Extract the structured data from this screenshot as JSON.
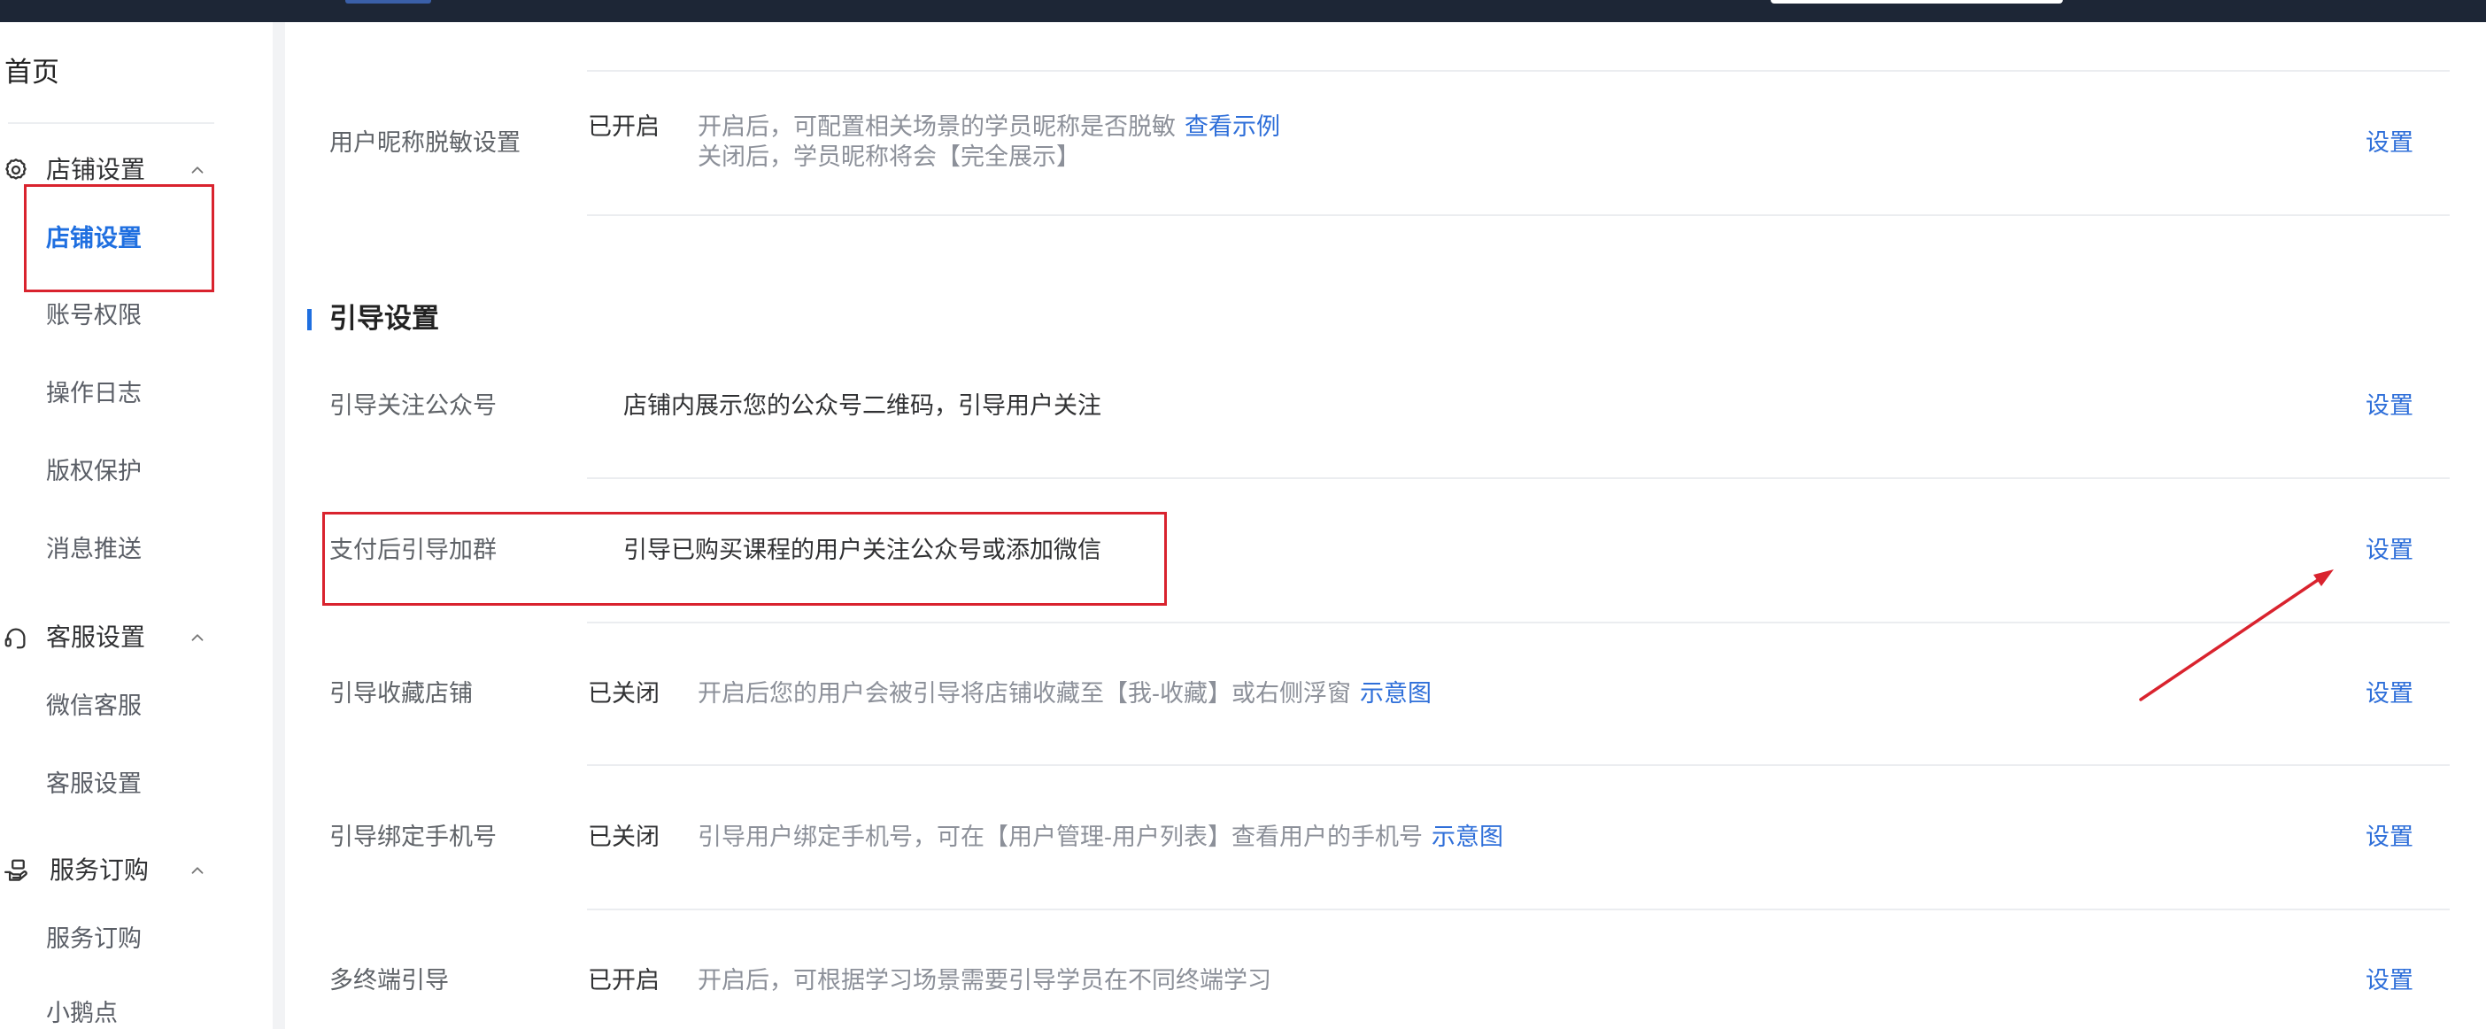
{
  "colors": {
    "topbar": "#1d2636",
    "accent": "#1f6fe0",
    "link": "#2f6fd9",
    "annotation": "#d9232e"
  },
  "sidebar": {
    "home": "首页",
    "groups": [
      {
        "title": "店铺设置",
        "icon": "gear-icon",
        "expanded": true,
        "items": [
          {
            "label": "店铺设置",
            "active": true
          },
          {
            "label": "账号权限"
          },
          {
            "label": "操作日志"
          },
          {
            "label": "版权保护"
          },
          {
            "label": "消息推送"
          }
        ]
      },
      {
        "title": "客服设置",
        "icon": "headset-icon",
        "expanded": true,
        "items": [
          {
            "label": "微信客服"
          },
          {
            "label": "客服设置"
          }
        ]
      },
      {
        "title": "服务订购",
        "icon": "hand-service-icon",
        "expanded": true,
        "items": [
          {
            "label": "服务订购"
          },
          {
            "label": "小鹅点"
          }
        ]
      }
    ]
  },
  "settings": {
    "nickname_row": {
      "label": "用户昵称脱敏设置",
      "status": "已开启",
      "desc_line1": "开启后，可配置相关场景的学员昵称是否脱敏",
      "link": "查看示例",
      "desc_line2": "关闭后，学员昵称将会【完全展示】",
      "action": "设置"
    },
    "guide_section": {
      "title": "引导设置",
      "rows": [
        {
          "label": "引导关注公众号",
          "desc": "店铺内展示您的公众号二维码，引导用户关注",
          "action": "设置"
        },
        {
          "label": "支付后引导加群",
          "desc": "引导已购买课程的用户关注公众号或添加微信",
          "action": "设置"
        },
        {
          "label": "引导收藏店铺",
          "status": "已关闭",
          "desc": "开启后您的用户会被引导将店铺收藏至【我-收藏】或右侧浮窗",
          "link": "示意图",
          "action": "设置"
        },
        {
          "label": "引导绑定手机号",
          "status": "已关闭",
          "desc": "引导用户绑定手机号，可在【用户管理-用户列表】查看用户的手机号",
          "link": "示意图",
          "action": "设置"
        },
        {
          "label": "多终端引导",
          "status": "已开启",
          "desc": "开启后，可根据学习场景需要引导学员在不同终端学习",
          "action": "设置"
        }
      ]
    }
  }
}
